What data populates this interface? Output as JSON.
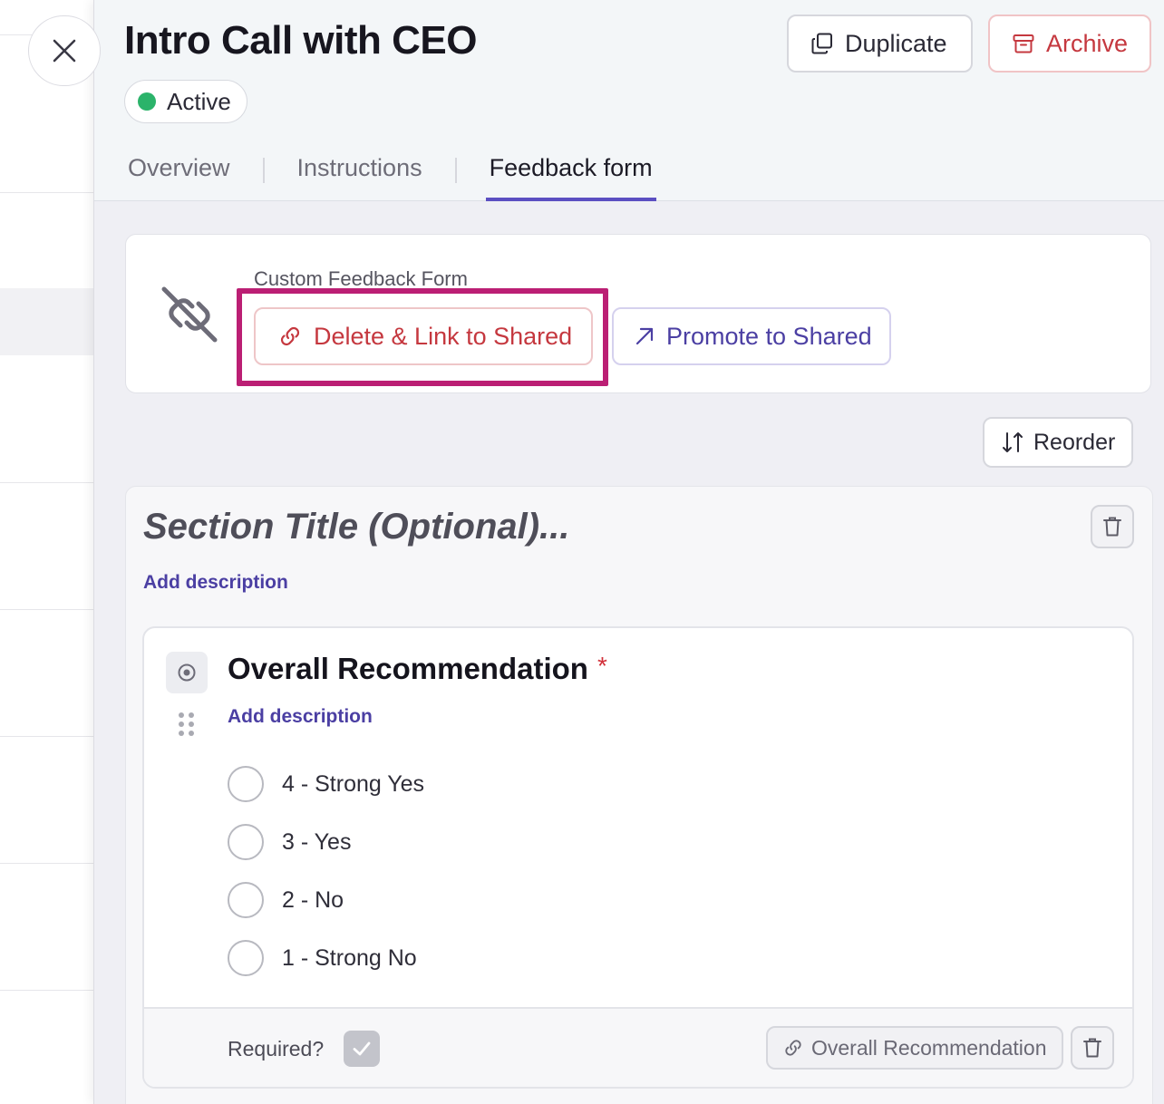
{
  "window": {
    "title": "Intro Call with CEO",
    "status": "Active",
    "status_color": "#2bb36a"
  },
  "actions": {
    "duplicate_label": "Duplicate",
    "archive_label": "Archive"
  },
  "tabs": [
    {
      "label": "Overview",
      "active": false
    },
    {
      "label": "Instructions",
      "active": false
    },
    {
      "label": "Feedback form",
      "active": true
    }
  ],
  "custom_form": {
    "label": "Custom Feedback Form",
    "delete_link_label": "Delete & Link to Shared",
    "promote_label": "Promote to Shared",
    "highlight_color": "#bb1f74"
  },
  "reorder_label": "Reorder",
  "section": {
    "title_placeholder": "Section Title (Optional)...",
    "add_description": "Add description"
  },
  "question": {
    "title": "Overall Recommendation",
    "required_marker": "*",
    "add_description": "Add description",
    "options": [
      {
        "label": "4 - Strong Yes"
      },
      {
        "label": "3 - Yes"
      },
      {
        "label": "2 - No"
      },
      {
        "label": "1 - Strong No"
      }
    ],
    "required_label": "Required?",
    "required_checked": true,
    "linked_field_label": "Overall Recommendation"
  },
  "colors": {
    "accent": "#5b4fc2",
    "link": "#4b3fa3",
    "danger": "#c5383f"
  }
}
